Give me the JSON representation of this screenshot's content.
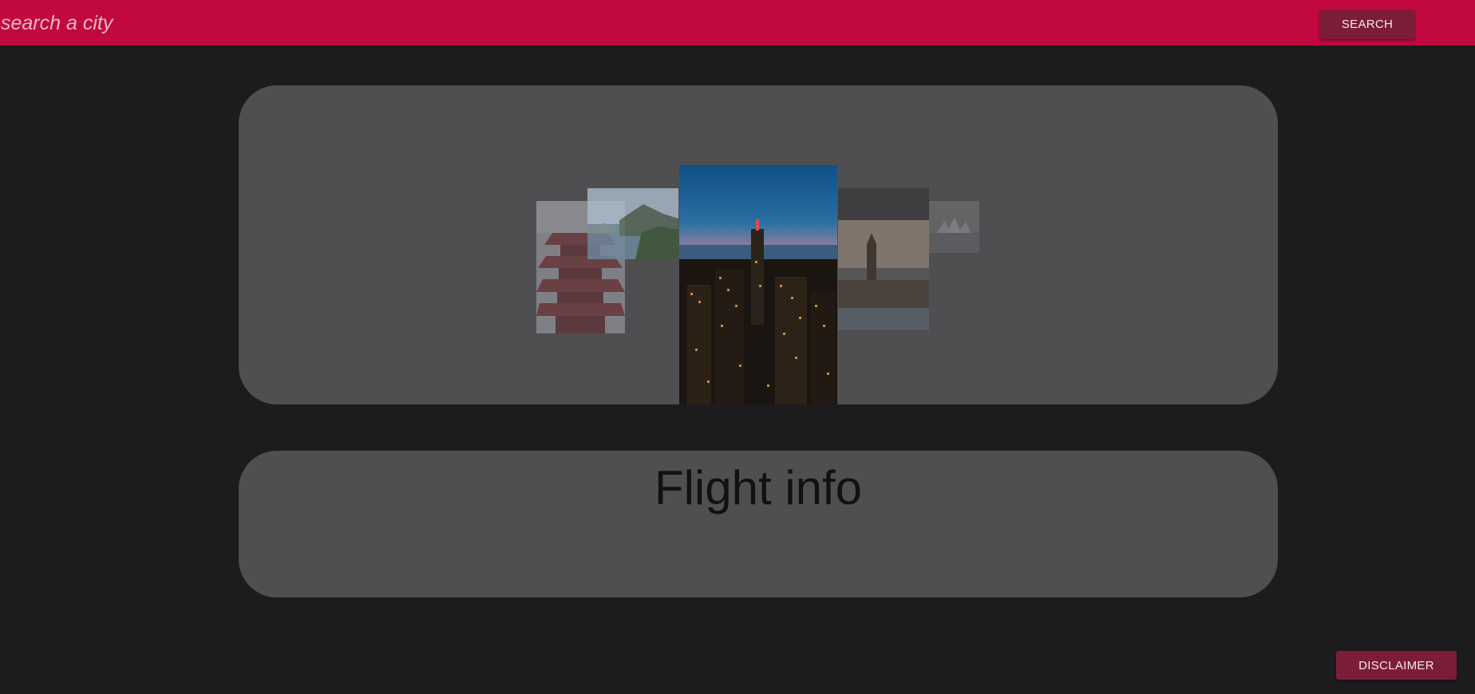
{
  "header": {
    "search": {
      "placeholder": "search a city",
      "value": ""
    },
    "search_button_label": "SEARCH"
  },
  "carousel": {
    "slides": [
      {
        "name": "pagoda-slide",
        "active": false
      },
      {
        "name": "coastal-mountain-slide",
        "active": false
      },
      {
        "name": "city-skyline-night-slide",
        "active": true
      },
      {
        "name": "clock-tower-river-slide",
        "active": false
      },
      {
        "name": "harbour-opera-slide",
        "active": false
      }
    ]
  },
  "flight": {
    "title": "Flight info"
  },
  "footer": {
    "disclaimer_label": "DISCLAIMER"
  },
  "colors": {
    "header_bg": "#c2093f",
    "button_bg": "#7c1d38",
    "page_bg": "#1c1c1e",
    "card_bg": "#4f4f51"
  }
}
